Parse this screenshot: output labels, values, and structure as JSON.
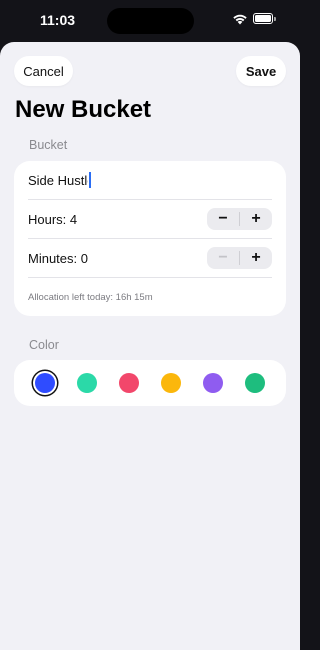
{
  "status": {
    "time": "11:03"
  },
  "nav": {
    "cancel_label": "Cancel",
    "save_label": "Save"
  },
  "title": "New Bucket",
  "bucket": {
    "section_label": "Bucket",
    "name_value": "Side Hustle",
    "hours_label": "Hours: 4",
    "hours": 4,
    "minutes_label": "Minutes: 0",
    "minutes": 0,
    "minus_symbol": "−",
    "plus_symbol": "+",
    "allocation_text": "Allocation left today: 16h 15m"
  },
  "color": {
    "section_label": "Color",
    "swatches": [
      {
        "name": "blue",
        "hex": "#2f4cff",
        "selected": true
      },
      {
        "name": "teal",
        "hex": "#2bd9a8",
        "selected": false
      },
      {
        "name": "pink",
        "hex": "#f2476b",
        "selected": false
      },
      {
        "name": "amber",
        "hex": "#fbb70c",
        "selected": false
      },
      {
        "name": "purple",
        "hex": "#8f5cf0",
        "selected": false
      },
      {
        "name": "green",
        "hex": "#1ebd7e",
        "selected": false
      }
    ]
  }
}
